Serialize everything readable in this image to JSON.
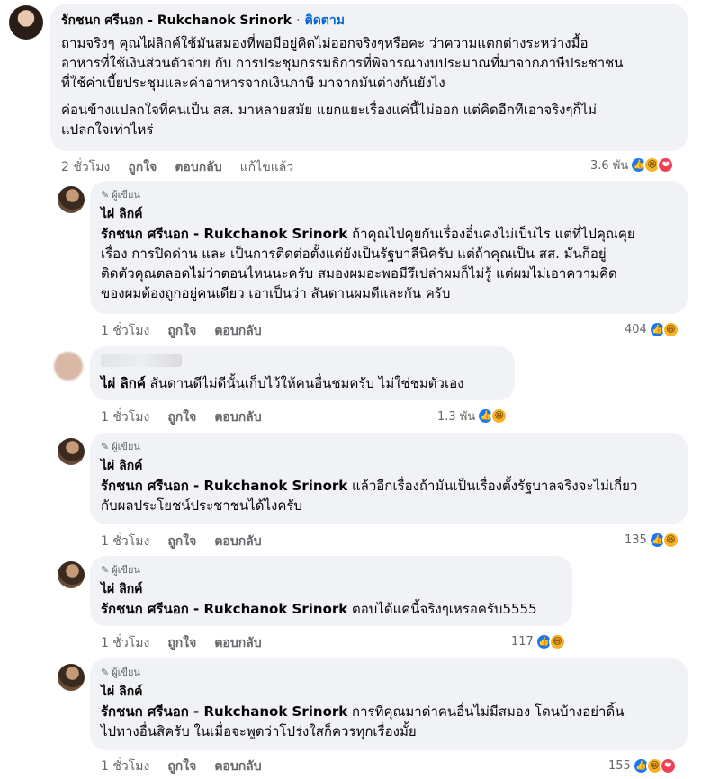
{
  "main_comment": {
    "author": "รักชนก ศรีนอก - Rukchanok Srinork",
    "separator": "·",
    "follow": "ติดตาม",
    "line1": "ถามจริงๆ คุณไผ่ลิกค์ใช้มันสมองที่พอมีอยู่คิดไม่ออกจริงๆหรือคะ ว่าความแตกต่างระหว่างมื้อ",
    "line2": "อาหารที่ใช้เงินส่วนตัวจ่าย กับ การประชุมกรรมธิการที่พิจารณางบประมาณที่มาจากภาษีประชาชน",
    "line3": "ที่ใช้ค่าเบี้ยประชุมและค่าอาหารจากเงินภาษี มาจากมันต่างกันยังไง",
    "line4": "ค่อนข้างแปลกใจที่คนเป็น สส. มาหลายสมัย แยกแยะเรื่องแค่นี้ไม่ออก แต่คิดอีกทีเอาจริงๆก็ไม่",
    "line5": "แปลกใจเท่าไหร่",
    "time": "2 ชั่วโมง",
    "like": "ถูกใจ",
    "reply": "ตอบกลับ",
    "edited": "แก้ไขแล้ว",
    "reaction_count": "3.6 พัน"
  },
  "replies": [
    {
      "badge": "ผู้เขียน",
      "name": "ไผ่ ลิกค์",
      "mention": "รักชนก ศรีนอก - Rukchanok Srinork",
      "line1": " ถ้าคุณไปคุยกันเรื่องอื่นคงไม่เป็นไร แต่ที่ไปคุณคุย",
      "line2": "เรื่อง การปิดด่าน และ เป็นการติดต่อตั้งแต่ยังเป็นรัฐบาลีนิครับ แต่ถ้าคุณเป็น สส. มันก็อยู่",
      "line3": "ติดตัวคุณตลอดไม่ว่าตอนไหนนะครับ สมองผมอะพอมีรึเปล่าผมก็ไม่รู้ แต่ผมไม่เอาความคิด",
      "line4": "ของผมต้องถูกอยู่คนเดียว เอาเป็นว่า สันดานผมดีและกัน ครับ",
      "time": "1 ชั่วโมง",
      "like": "ถูกใจ",
      "reply": "ตอบกลับ",
      "count": "404"
    },
    {
      "mention": "ไผ่ ลิกค์",
      "line1": " สันดานดีไม่ดีนั้นเก็บไว้ให้คนอื่นชมครับ ไม่ใช่ชมตัวเอง",
      "time": "1 ชั่วโมง",
      "like": "ถูกใจ",
      "reply": "ตอบกลับ",
      "count": "1.3 พัน"
    },
    {
      "badge": "ผู้เขียน",
      "name": "ไผ่ ลิกค์",
      "mention": "รักชนก ศรีนอก - Rukchanok Srinork",
      "line1": " แล้วอีกเรื่องถ้ามันเป็นเรื่องตั้งรัฐบาลจริงจะไม่เกี่ยว",
      "line2": "กับผลประโยชน์ประชาชนได้ไงครับ",
      "time": "1 ชั่วโมง",
      "like": "ถูกใจ",
      "reply": "ตอบกลับ",
      "count": "135"
    },
    {
      "badge": "ผู้เขียน",
      "name": "ไผ่ ลิกค์",
      "mention": "รักชนก ศรีนอก - Rukchanok Srinork",
      "line1": " ตอบได้แค่นี้จริงๆเหรอครับ5555",
      "time": "1 ชั่วโมง",
      "like": "ถูกใจ",
      "reply": "ตอบกลับ",
      "count": "117"
    },
    {
      "badge": "ผู้เขียน",
      "name": "ไผ่ ลิกค์",
      "mention": "รักชนก ศรีนอก - Rukchanok Srinork",
      "line1": " การที่คุณมาด่าคนอื่นไม่มีสมอง โดนบ้างอย่าดิ้น",
      "line2": "ไปทางอื่นสิครับ ในเมื่อจะพูดว่าโปร่งใสก็ควรทุกเรื่องมั้ย",
      "time": "1 ชั่วโมง",
      "like": "ถูกใจ",
      "reply": "ตอบกลับ",
      "count": "155"
    }
  ],
  "colors": {
    "bubble": "#f0f2f5",
    "link": "#0064d1",
    "meta": "#65676b",
    "like": "#1877f2",
    "haha": "#f7b125",
    "love": "#f33e58"
  },
  "icons": [
    "pencil-icon",
    "like-reaction-icon",
    "haha-reaction-icon",
    "love-reaction-icon"
  ]
}
